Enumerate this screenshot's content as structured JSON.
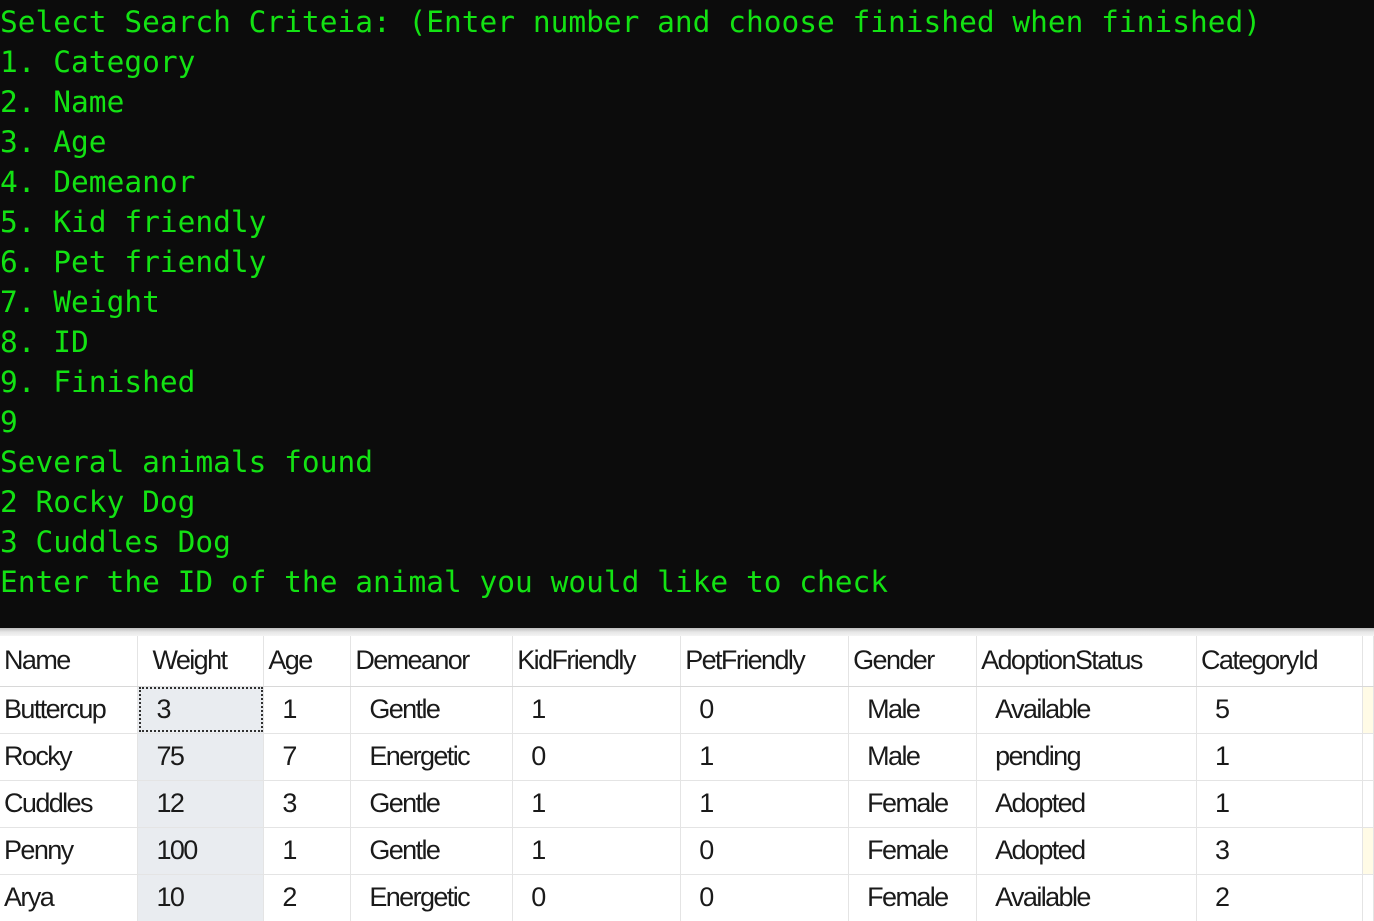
{
  "console": {
    "lines": [
      "Select Search Criteia: (Enter number and choose finished when finished)",
      "1. Category",
      "2. Name",
      "3. Age",
      "4. Demeanor",
      "5. Kid friendly",
      "6. Pet friendly",
      "7. Weight",
      "8. ID",
      "9. Finished",
      "9",
      "Several animals found",
      "2 Rocky Dog",
      "3 Cuddles Dog",
      "Enter the ID of the animal you would like to check"
    ],
    "text_color": "#13e213",
    "background_color": "#0c0c0c"
  },
  "grid": {
    "columns": [
      "Name",
      "Weight",
      "Age",
      "Demeanor",
      "KidFriendly",
      "PetFriendly",
      "Gender",
      "AdoptionStatus",
      "CategoryId"
    ],
    "rows": [
      {
        "name": "Buttercup",
        "weight": "3",
        "age": "1",
        "demeanor": "Gentle",
        "kid": "1",
        "pet": "0",
        "gender": "Male",
        "status": "Available",
        "category": "5"
      },
      {
        "name": "Rocky",
        "weight": "75",
        "age": "7",
        "demeanor": "Energetic",
        "kid": "0",
        "pet": "1",
        "gender": "Male",
        "status": "pending",
        "category": "1"
      },
      {
        "name": "Cuddles",
        "weight": "12",
        "age": "3",
        "demeanor": "Gentle",
        "kid": "1",
        "pet": "1",
        "gender": "Female",
        "status": "Adopted",
        "category": "1"
      },
      {
        "name": "Penny",
        "weight": "100",
        "age": "1",
        "demeanor": "Gentle",
        "kid": "1",
        "pet": "0",
        "gender": "Female",
        "status": "Adopted",
        "category": "3"
      },
      {
        "name": "Arya",
        "weight": "10",
        "age": "2",
        "demeanor": "Energetic",
        "kid": "0",
        "pet": "0",
        "gender": "Female",
        "status": "Available",
        "category": "2"
      }
    ],
    "selected_cell": "Buttercup weight",
    "selected_column_color": "#e9ecf0"
  }
}
